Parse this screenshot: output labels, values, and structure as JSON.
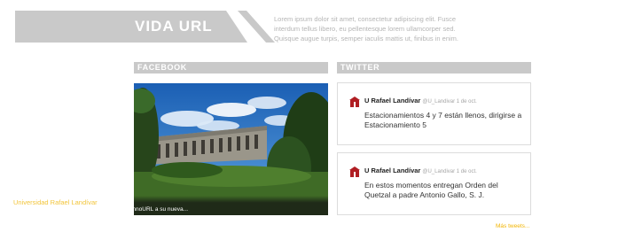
{
  "header": {
    "title": "VIDA URL",
    "intro": "Lorem ipsum dolor sit amet, consectetur adipiscing elit. Fusce interdum tellus libero, eu pellentesque lorem ullamcorper sed. Quisque augue turpis, semper iaculis mattis ut, finibus in enim."
  },
  "facebook": {
    "section_title": "FACEBOOK",
    "post_name": "Universidad Rafael Landívar",
    "post_text": "Bienvenidos a todos los nuevos alumnos #AlumnoURL a su nueva..."
  },
  "twitter": {
    "section_title": "TWITTER",
    "tweets": [
      {
        "user": "U Rafael Landívar",
        "handle": "@U_Landivar 1 de oct.",
        "text": "Estacionamientos 4 y 7 están llenos, dirigirse a Estacionamiento 5"
      },
      {
        "user": "U Rafael Landívar",
        "handle": "@U_Landivar 1 de oct.",
        "text": "En estos momentos entregan Orden del Quetzal a padre Antonio Gallo, S. J."
      }
    ],
    "more_label": "Más tweets..."
  },
  "colors": {
    "banner_gray": "#c9c9c9",
    "accent_gold": "#f2c53b",
    "link_orange": "#f2b400"
  }
}
